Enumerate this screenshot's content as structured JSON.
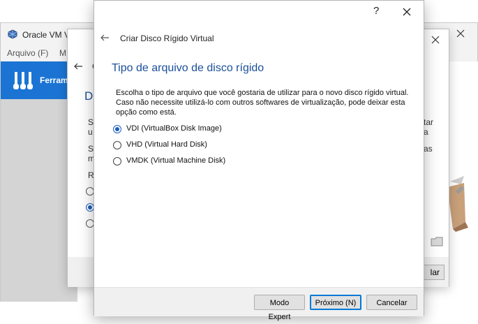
{
  "manager": {
    "title": "Oracle VM V",
    "menu": [
      "Arquivo (F)",
      "M"
    ],
    "tools_label": "Ferram"
  },
  "mid_dialog": {
    "heading": "Di",
    "frag1": "Se",
    "frag2": "u",
    "frag3": "Se",
    "frag4": "m",
    "frag5": "R",
    "frag_right1": "tar",
    "frag_right2": "a",
    "frag_right3": "as",
    "frag_back": "C",
    "cancel": "lar"
  },
  "dialog": {
    "help": "?",
    "title": "Criar Disco Rígido Virtual",
    "heading": "Tipo de arquivo de disco rígido",
    "description": [
      "Escolha o tipo de arquivo que você gostaria de utilizar para o novo disco rígido virtual.",
      "Caso não necessite utilizá-lo com outros softwares de virtualização, pode deixar esta",
      "opção como está."
    ],
    "options": [
      {
        "label": "VDI (VirtualBox Disk Image)",
        "checked": true
      },
      {
        "label": "VHD (Virtual Hard Disk)",
        "checked": false
      },
      {
        "label": "VMDK (Virtual Machine Disk)",
        "checked": false
      }
    ],
    "buttons": {
      "expert": "Modo Expert",
      "next": "Próximo (N)",
      "cancel": "Cancelar"
    }
  },
  "colors": {
    "heading": "#1b4f9a",
    "accent": "#1b5dbf",
    "tools_bar": "#1b74d4"
  }
}
